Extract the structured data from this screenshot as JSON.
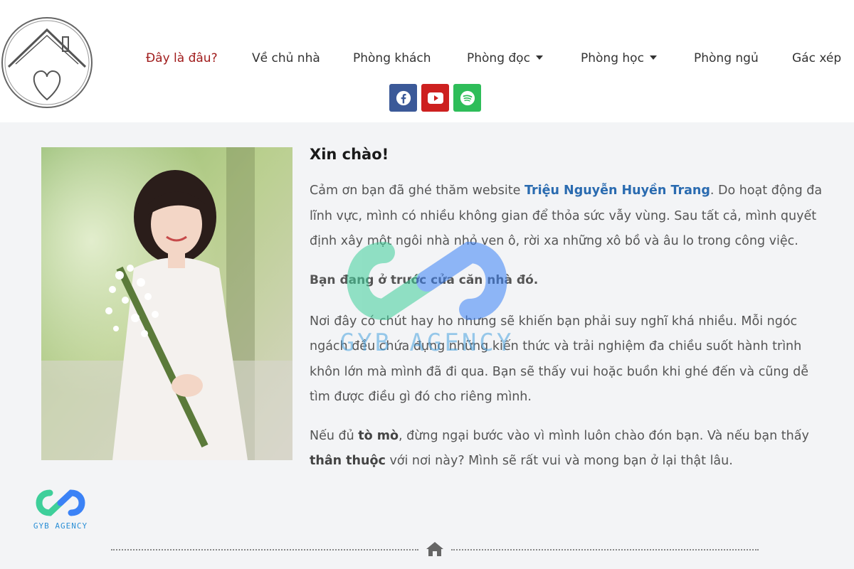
{
  "nav": {
    "items": [
      {
        "label": "Đây là đâu?",
        "active": true,
        "dropdown": false
      },
      {
        "label": "Về chủ nhà",
        "active": false,
        "dropdown": false
      },
      {
        "label": "Phòng khách",
        "active": false,
        "dropdown": false
      },
      {
        "label": "Phòng đọc",
        "active": false,
        "dropdown": true
      },
      {
        "label": "Phòng học",
        "active": false,
        "dropdown": true
      },
      {
        "label": "Phòng ngủ",
        "active": false,
        "dropdown": false
      },
      {
        "label": "Gác xép",
        "active": false,
        "dropdown": false
      }
    ]
  },
  "social": {
    "icons": [
      "facebook-icon",
      "youtube-icon",
      "spotify-icon"
    ],
    "colors": {
      "facebook": "#3b5998",
      "youtube": "#cd201f",
      "spotify": "#2ebd59"
    }
  },
  "content": {
    "greeting": "Xin chào!",
    "p1_before": "Cảm ơn bạn đã ghé thăm website ",
    "p1_link": "Triệu Nguyễn Huyền Trang",
    "p1_after": ". Do hoạt động đa lĩnh vực, mình có nhiều không gian để thỏa sức vẫy vùng. Sau tất cả, mình quyết định xây một ngôi nhà nhỏ ven ô, rời xa những xô bồ và âu lo trong công việc.",
    "subheading": "Bạn đang ở trước cửa căn nhà đó.",
    "p2": "Nơi đây có chút hay ho nhưng sẽ khiến bạn phải suy nghĩ khá nhiều. Mỗi ngóc ngách đều chứa đựng những kiến thức và trải nghiệm đa chiều suốt hành trình khôn lớn mà mình đã đi qua. Bạn sẽ thấy vui hoặc buồn khi ghé đến và cũng dễ tìm được điều gì đó cho riêng mình.",
    "p3_a": "Nếu đủ ",
    "p3_b": "tò mò",
    "p3_c": ", đừng ngại bước vào vì mình luôn chào đón bạn. Và nếu bạn thấy ",
    "p3_d": "thân thuộc",
    "p3_e": " với nơi này? Mình sẽ rất vui và mong bạn ở lại thật lâu."
  },
  "watermark": {
    "text": "GYB AGENCY"
  },
  "corner_logo": {
    "text": "GYB AGENCY"
  },
  "colors": {
    "accent_nav": "#a01c1c",
    "link": "#2a6bb0"
  }
}
